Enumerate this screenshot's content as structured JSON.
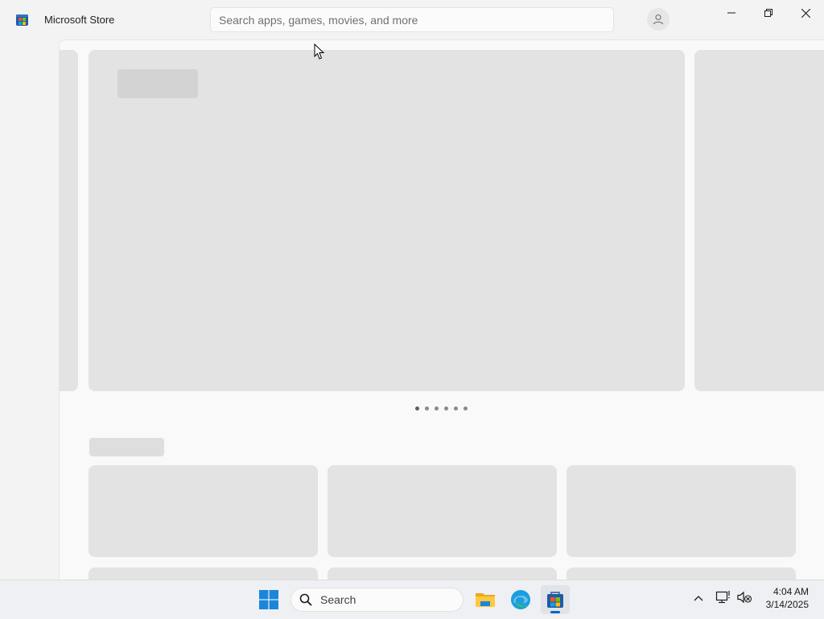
{
  "app": {
    "title": "Microsoft Store",
    "search_placeholder": "Search apps, games, movies, and more"
  },
  "window_controls": {
    "minimize_icon": "minimize-icon",
    "maximize_icon": "restore-icon",
    "close_icon": "close-icon"
  },
  "carousel": {
    "page_count": 6,
    "active_index": 0
  },
  "taskbar": {
    "search_label": "Search",
    "pinned": [
      "start",
      "file-explorer",
      "edge",
      "microsoft-store"
    ],
    "active_app": "microsoft-store"
  },
  "clock": {
    "time": "4:04 AM",
    "date": "3/14/2025"
  },
  "colors": {
    "accent": "#0067c0",
    "skeleton": "#e3e3e3",
    "background": "#f3f3f3"
  }
}
